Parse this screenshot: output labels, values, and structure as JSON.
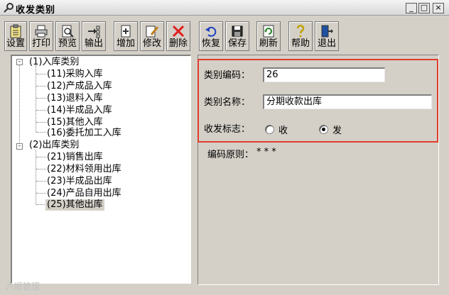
{
  "window": {
    "title": "收发类别",
    "min_symbol": "_",
    "max_symbol": "□",
    "close_symbol": "×"
  },
  "toolbar": {
    "buttons": [
      {
        "label": "设置",
        "icon": "clipboard-icon"
      },
      {
        "label": "打印",
        "icon": "printer-icon"
      },
      {
        "label": "预览",
        "icon": "preview-icon"
      },
      {
        "label": "输出",
        "icon": "export-icon"
      },
      {
        "label": "增加",
        "icon": "add-icon"
      },
      {
        "label": "修改",
        "icon": "edit-icon"
      },
      {
        "label": "删除",
        "icon": "delete-icon"
      },
      {
        "label": "恢复",
        "icon": "undo-icon"
      },
      {
        "label": "保存",
        "icon": "save-icon"
      },
      {
        "label": "刷新",
        "icon": "refresh-icon"
      },
      {
        "label": "帮助",
        "icon": "help-icon"
      },
      {
        "label": "退出",
        "icon": "exit-icon"
      }
    ]
  },
  "tree": {
    "group1": {
      "label": "(1)入库类别",
      "expander": "-",
      "items": [
        "(11)采购入库",
        "(12)产成品入库",
        "(13)退料入库",
        "(14)半成品入库",
        "(15)其他入库",
        "(16)委托加工入库"
      ]
    },
    "group2": {
      "label": "(2)出库类别",
      "expander": "-",
      "items": [
        "(21)销售出库",
        "(22)材料领用出库",
        "(23)半成品出库",
        "(24)产品自用出库",
        "(25)其他出库"
      ]
    },
    "selected": "(25)其他出库"
  },
  "form": {
    "code_label": "类别编码：",
    "code_value": "26",
    "name_label": "类别名称：",
    "name_value": "分期收款出库",
    "flag_label": "收发标志：",
    "option_receive": "收",
    "option_issue": "发",
    "selected_option": "发",
    "rule_label": "编码原则：",
    "rule_value": "* * *"
  },
  "colors": {
    "highlight_border": "#e03c2c",
    "panel_bg": "#d4d0c8"
  },
  "watermark": "六顺管理"
}
